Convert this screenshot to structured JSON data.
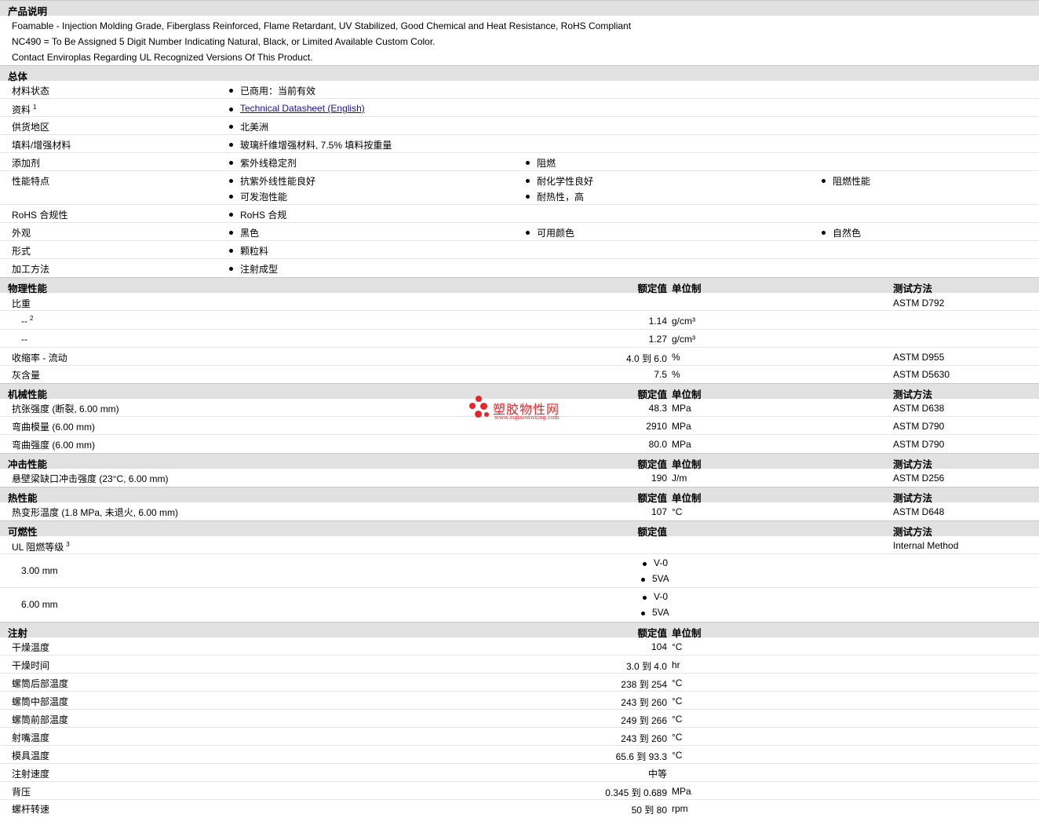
{
  "description": {
    "title": "产品说明",
    "lines": [
      "Foamable - Injection Molding Grade, Fiberglass Reinforced, Flame Retardant, UV Stabilized, Good Chemical and Heat Resistance, RoHS Compliant",
      "NC490 = To Be Assigned 5 Digit Number Indicating Natural, Black, or Limited Available Custom Color.",
      "Contact Enviroplas Regarding UL Recognized Versions Of This Product."
    ]
  },
  "general": {
    "title": "总体",
    "rows": [
      {
        "label": "材料状态",
        "items": [
          "已商用：当前有效"
        ]
      },
      {
        "label": "资料",
        "sup": "1",
        "items": [
          "Technical Datasheet (English)"
        ]
      },
      {
        "label": "供货地区",
        "items": [
          "北美洲"
        ]
      },
      {
        "label": "填料/增强材料",
        "items": [
          "玻璃纤维增强材料, 7.5% 填料按重量"
        ]
      },
      {
        "label": "添加剂",
        "items": [
          "紫外线稳定剂",
          "阻燃"
        ]
      },
      {
        "label": "性能特点",
        "items": [
          "抗紫外线性能良好",
          "耐化学性良好",
          "阻燃性能",
          "可发泡性能",
          "耐热性，高"
        ]
      },
      {
        "label": "RoHS 合规性",
        "items": [
          "RoHS 合规"
        ]
      },
      {
        "label": "外观",
        "items": [
          "黑色",
          "可用颜色",
          "自然色"
        ]
      },
      {
        "label": "形式",
        "items": [
          "颗粒料"
        ]
      },
      {
        "label": "加工方法",
        "items": [
          "注射成型"
        ]
      }
    ]
  },
  "headers": {
    "value": "额定值",
    "unit": "单位制",
    "method": "测试方法"
  },
  "physical": {
    "title": "物理性能",
    "rows": [
      {
        "label": "比重",
        "value": "",
        "unit": "",
        "method": "ASTM D792"
      },
      {
        "label": "--",
        "sup": "2",
        "value": "1.14",
        "unit": "g/cm³",
        "method": ""
      },
      {
        "label": "--",
        "value": "1.27",
        "unit": "g/cm³",
        "method": ""
      },
      {
        "label": "收缩率 - 流动",
        "value": "4.0 到 6.0",
        "unit": "%",
        "method": "ASTM D955"
      },
      {
        "label": "灰含量",
        "value": "7.5",
        "unit": "%",
        "method": "ASTM D5630"
      }
    ]
  },
  "mechanical": {
    "title": "机械性能",
    "rows": [
      {
        "label": "抗张强度 (断裂, 6.00 mm)",
        "value": "48.3",
        "unit": "MPa",
        "method": "ASTM D638"
      },
      {
        "label": "弯曲模量 (6.00 mm)",
        "value": "2910",
        "unit": "MPa",
        "method": "ASTM D790"
      },
      {
        "label": "弯曲强度 (6.00 mm)",
        "value": "80.0",
        "unit": "MPa",
        "method": "ASTM D790"
      }
    ]
  },
  "impact": {
    "title": "冲击性能",
    "rows": [
      {
        "label": "悬壁梁缺口冲击强度 (23°C, 6.00 mm)",
        "value": "190",
        "unit": "J/m",
        "method": "ASTM D256"
      }
    ]
  },
  "thermal": {
    "title": "热性能",
    "rows": [
      {
        "label": "热变形温度 (1.8 MPa, 未退火, 6.00 mm)",
        "value": "107",
        "unit": "°C",
        "method": "ASTM D648"
      }
    ]
  },
  "flammability": {
    "title": "可燃性",
    "rows": [
      {
        "label": "UL 阻燃等级",
        "sup": "3",
        "method": "Internal Method"
      },
      {
        "label": "3.00 mm",
        "items": [
          "V-0",
          "5VA"
        ]
      },
      {
        "label": "6.00 mm",
        "items": [
          "V-0",
          "5VA"
        ]
      }
    ]
  },
  "injection": {
    "title": "注射",
    "rows": [
      {
        "label": "干燥温度",
        "value": "104",
        "unit": "°C"
      },
      {
        "label": "干燥时间",
        "value": "3.0 到 4.0",
        "unit": "hr"
      },
      {
        "label": "螺筒后部温度",
        "value": "238 到 254",
        "unit": "°C"
      },
      {
        "label": "螺筒中部温度",
        "value": "243 到 260",
        "unit": "°C"
      },
      {
        "label": "螺筒前部温度",
        "value": "249 到 266",
        "unit": "°C"
      },
      {
        "label": "射嘴温度",
        "value": "243 到 260",
        "unit": "°C"
      },
      {
        "label": "模具温度",
        "value": "65.6 到 93.3",
        "unit": "°C"
      },
      {
        "label": "注射速度",
        "value": "中等",
        "unit": ""
      },
      {
        "label": "背压",
        "value": "0.345 到 0.689",
        "unit": "MPa"
      },
      {
        "label": "螺杆转速",
        "value": "50 到 80",
        "unit": "rpm"
      }
    ]
  },
  "watermark": {
    "cn": "塑胶物性网",
    "en": "www.sujiaowuxing.com",
    "color": "#e8252b"
  }
}
